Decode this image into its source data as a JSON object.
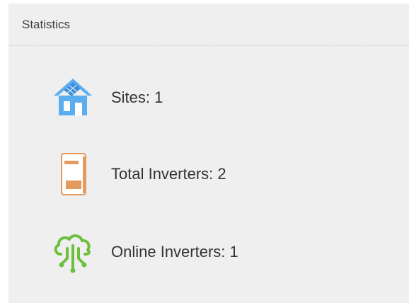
{
  "panel": {
    "title": "Statistics"
  },
  "stats": [
    {
      "icon": "solar-house-icon",
      "label": "Sites: 1",
      "color": "#5aaef0"
    },
    {
      "icon": "inverter-icon",
      "label": "Total Inverters: 2",
      "color": "#e59a5e"
    },
    {
      "icon": "cloud-network-icon",
      "label": "Online Inverters: 1",
      "color": "#6cbf3c"
    }
  ]
}
